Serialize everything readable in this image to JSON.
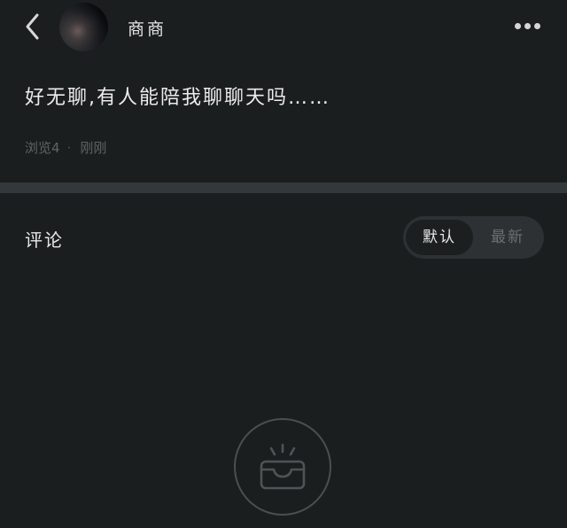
{
  "header": {
    "username": "商商",
    "back_icon": "chevron-left-icon",
    "more_icon": "more-horizontal-icon"
  },
  "post": {
    "text": "好无聊,有人能陪我聊聊天吗……",
    "views_label": "浏览4",
    "time": "刚刚"
  },
  "comments": {
    "title": "评论",
    "sort_options": [
      "默认",
      "最新"
    ],
    "selected_sort": "默认",
    "empty_icon": "empty-inbox-icon"
  },
  "colors": {
    "background": "#1b1e1e",
    "divider": "#33383b",
    "toggle_bg": "#2d3133"
  }
}
